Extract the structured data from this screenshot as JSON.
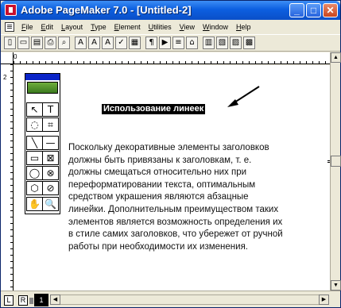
{
  "window": {
    "title": "Adobe PageMaker 7.0 - [Untitled-2]",
    "minimize": "_",
    "maximize": "□",
    "close": "✕"
  },
  "menu": {
    "items": [
      {
        "u": "F",
        "rest": "ile"
      },
      {
        "u": "E",
        "rest": "dit"
      },
      {
        "u": "L",
        "rest": "ayout"
      },
      {
        "u": "T",
        "rest": "ype"
      },
      {
        "u": "E",
        "rest": "lement"
      },
      {
        "u": "U",
        "rest": "tilities"
      },
      {
        "u": "V",
        "rest": "iew"
      },
      {
        "u": "W",
        "rest": "indow"
      },
      {
        "u": "H",
        "rest": "elp"
      }
    ]
  },
  "toolbar": {
    "buttons": [
      "▯",
      "▭",
      "▤",
      "⎙",
      "⌕",
      "A",
      "A",
      "A",
      "✓",
      "▦",
      "¶",
      "▶",
      "≡",
      "⌂",
      "▥",
      "▧",
      "▨",
      "▩"
    ]
  },
  "ruler": {
    "h_labels": [
      "0"
    ],
    "v_labels": [
      "2"
    ]
  },
  "toolbox": {
    "tools": [
      "↖",
      "T",
      "◌",
      "⌗",
      "╲",
      "—",
      "▭",
      "⊠",
      "◯",
      "⊗",
      "⬡",
      "⊘",
      "✋",
      "🔍"
    ]
  },
  "document": {
    "headline": "Использование линеек",
    "body_lines": [
      "Поскольку декоративные элементы заголовков",
      "должны быть привязаны к заголовкам, т. е.",
      "должны смещаться относительно них при",
      "переформатировании текста, оптимальным",
      "средством украшения являются абзацные",
      "линейки. Дополнительным преимуществом таких",
      "элементов является возможность определения их",
      "в стиле самих заголовков, что убережет от ручной",
      "работы при необходимости их изменения."
    ]
  },
  "pages": {
    "left": "L",
    "right": "R",
    "current": "1"
  },
  "colors": {
    "titlebar": "#0c5fe0",
    "toolbox_title": "#0a24c8",
    "chrome": "#ece9d8"
  }
}
